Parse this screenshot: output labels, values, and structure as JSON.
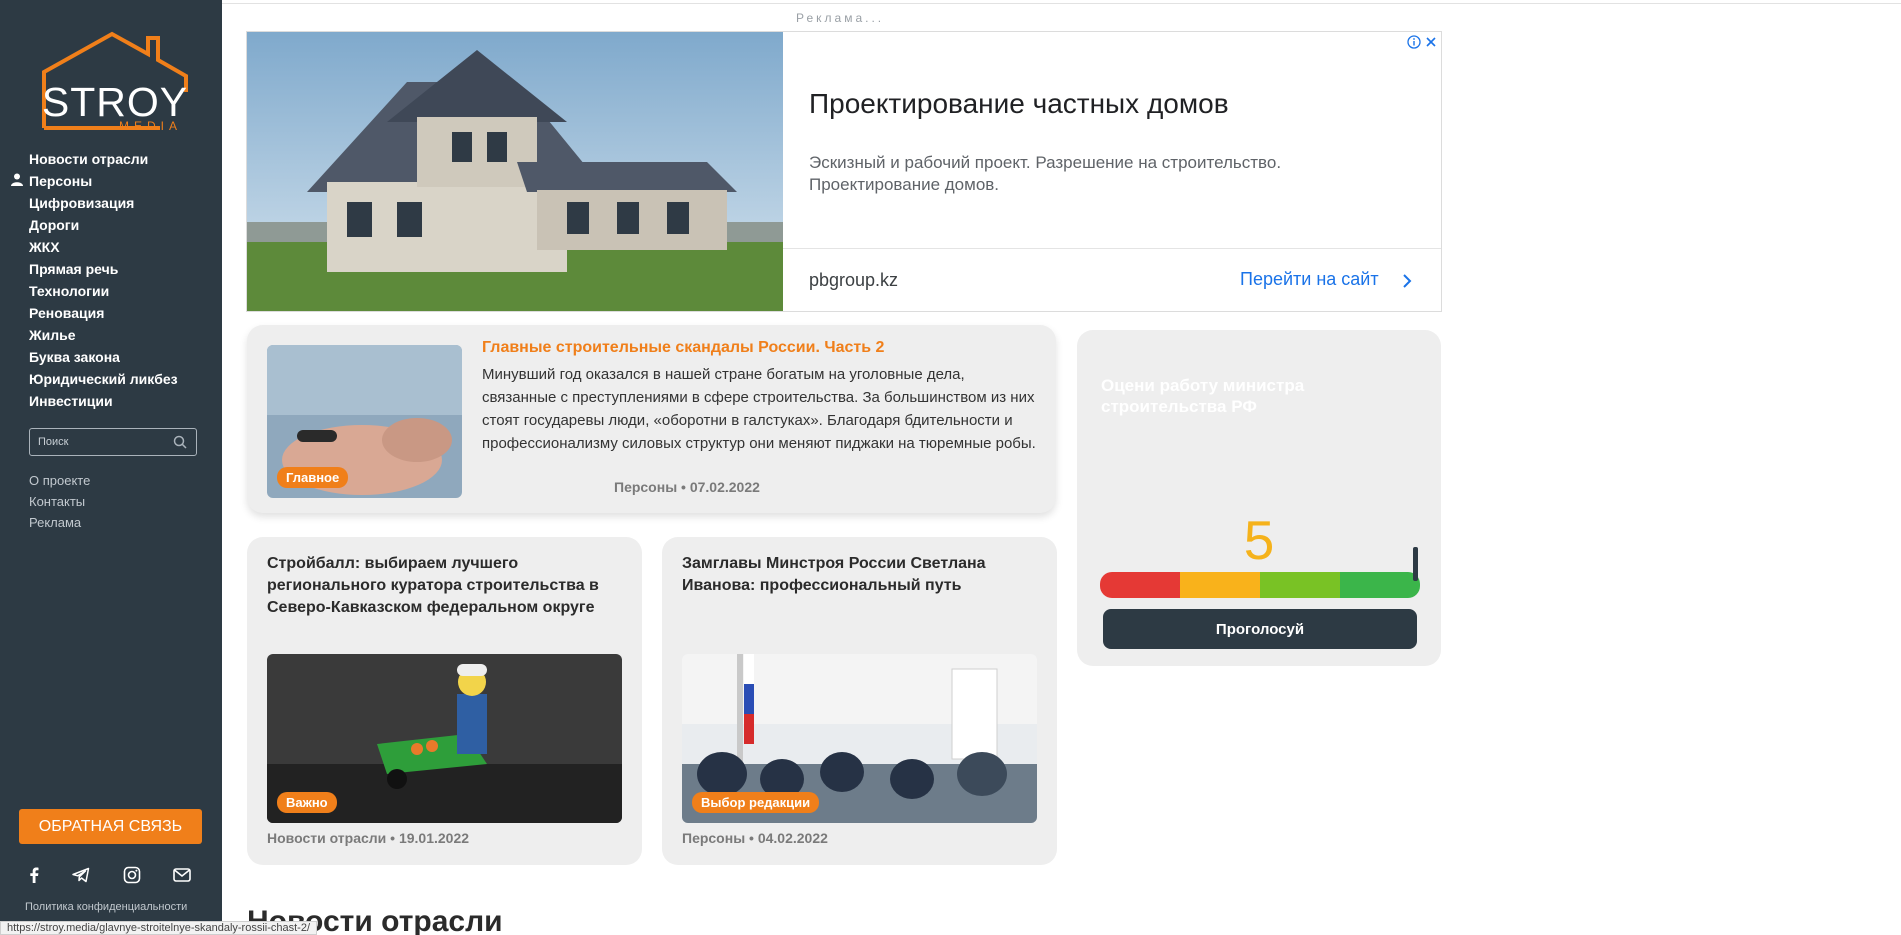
{
  "sidebar": {
    "logo": {
      "word": "STROY",
      "sub": "MEDIA"
    },
    "nav": [
      {
        "label": "Новости отрасли"
      },
      {
        "label": "Персоны"
      },
      {
        "label": "Цифровизация"
      },
      {
        "label": "Дороги"
      },
      {
        "label": "ЖКХ"
      },
      {
        "label": "Прямая речь"
      },
      {
        "label": "Технологии"
      },
      {
        "label": "Реновация"
      },
      {
        "label": "Жилье"
      },
      {
        "label": "Буква закона"
      },
      {
        "label": "Юридический ликбез"
      },
      {
        "label": "Инвестиции"
      }
    ],
    "search": {
      "placeholder": "Поиск"
    },
    "links": [
      {
        "label": "О проекте"
      },
      {
        "label": "Контакты"
      },
      {
        "label": "Реклама"
      }
    ],
    "feedback_label": "ОБРАТНАЯ СВЯЗЬ",
    "socials": [
      "facebook-icon",
      "telegram-icon",
      "instagram-icon",
      "mail-icon"
    ],
    "privacy": "Политика конфиденциальности"
  },
  "ad": {
    "label": "Реклама...",
    "title": "Проектирование частных домов",
    "description": "Эскизный и рабочий проект. Разрешение на строительство. Проектирование домов.",
    "domain": "pbgroup.kz",
    "cta": "Перейти на сайт"
  },
  "main_article": {
    "title": "Главные строительные скандалы России. Часть 2",
    "excerpt": "Минувший год оказался в нашей стране богатым на уголовные дела, связанные с преступлениями в сфере строительства. За большинством из них стоят государевы люди, «оборотни в галстуках». Благодаря бдительности и профессионализму силовых структур они меняют пиджаки на тюремные робы.",
    "badge": "Главное",
    "meta": "Персоны • 07.02.2022"
  },
  "articles": [
    {
      "title": "Стройбалл: выбираем лучшего регионального куратора строительства в Северо-Кавказском федеральном округе",
      "badge": "Важно",
      "meta": "Новости отрасли • 19.01.2022"
    },
    {
      "title": "Замглавы Минстроя России Светлана Иванова: профессиональный путь",
      "badge": "Выбор редакции",
      "meta": "Персоны • 04.02.2022"
    }
  ],
  "vote": {
    "title": "Оцени работу министра строительства РФ",
    "value": "5",
    "button": "Проголосуй",
    "level": 1.0,
    "colors": [
      "#e53935",
      "#f9b21b",
      "#79c225",
      "#3bb54a"
    ]
  },
  "section_heading": "Новости отрасли",
  "status_url": "https://stroy.media/glavnye-stroitelnye-skandaly-rossii-chast-2/"
}
